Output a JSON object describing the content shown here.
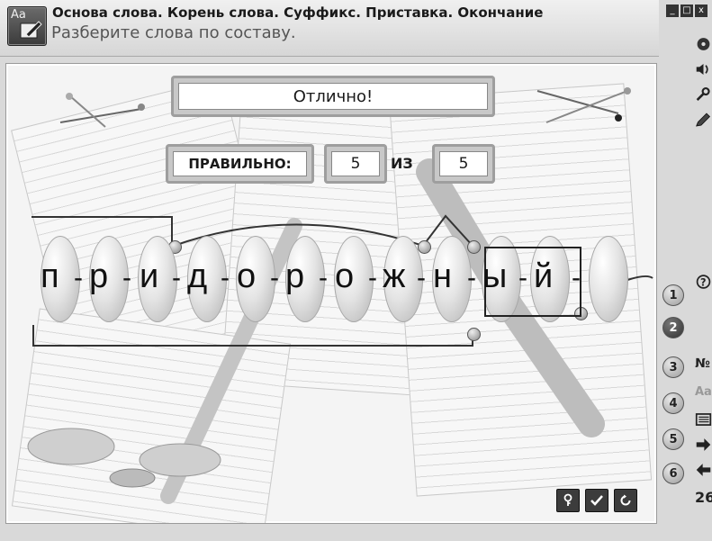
{
  "header": {
    "title": "Основа слова. Корень слова. Суффикс. Приставка. Окончание",
    "subtitle": "Разберите слова по составу.",
    "app_icon_letters": "Aa"
  },
  "window_controls": [
    "_",
    "□",
    "x"
  ],
  "result": {
    "message": "Отлично!",
    "correct_label": "ПРАВИЛЬНО:",
    "correct_count": "5",
    "of_label": "ИЗ",
    "total_count": "5"
  },
  "word": {
    "letters": [
      "п",
      "р",
      "и",
      "д",
      "о",
      "р",
      "о",
      "ж",
      "н",
      "ы",
      "й"
    ],
    "separator": "-"
  },
  "steps": [
    {
      "label": "1"
    },
    {
      "label": "2"
    },
    {
      "label": "3"
    },
    {
      "label": "4"
    },
    {
      "label": "5"
    },
    {
      "label": "6"
    }
  ],
  "right_tools": {
    "help": "?",
    "number_sign": "№",
    "font": "Aa",
    "page_number": "26"
  },
  "icons": [
    "disc-icon",
    "speaker-icon",
    "wrench-icon",
    "pencil-icon",
    "help-icon",
    "list-icon",
    "arrow-right-icon",
    "arrow-left-icon",
    "key-icon",
    "check-icon",
    "undo-icon"
  ]
}
